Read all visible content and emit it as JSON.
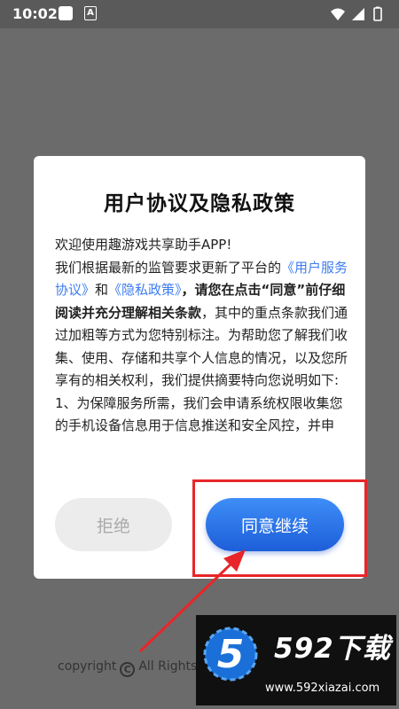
{
  "status_bar": {
    "time": "10:02",
    "notification_letter": "A"
  },
  "background": {
    "copyright_prefix": "copyright",
    "copyright_symbol": "C",
    "copyright_suffix": "All Rights"
  },
  "dialog": {
    "title": "用户协议及隐私政策",
    "p1": "欢迎使用趣游戏共享助手APP!",
    "p2_a": "我们根据最新的监管要求更新了平台的",
    "p2_link1": "《用户服务协议》",
    "p2_and": "和",
    "p2_link2": "《隐私政策》",
    "p2_bold": "，请您在点击“同意”前仔细阅读并充分理解相关条款",
    "p2_b": "，其中的重点条款我们通过加粗等方式为您特别标注。为帮助您了解我们收集、使用、存储和共享个人信息的情况，以及您所享有的相关权利，我们提供摘要特向您说明如下:",
    "p3": "1、为保障服务所需，我们会申请系统权限收集您的手机设备信息用于信息推送和安全风控，并申",
    "reject_label": "拒绝",
    "agree_label": "同意继续"
  },
  "watermark": {
    "logo_digit": "5",
    "brand": "592下载",
    "url": "www.592xiazai.com"
  },
  "colors": {
    "link": "#3d7cf0",
    "agree_button": "#2a6ee8",
    "highlight": "#e8262a"
  }
}
